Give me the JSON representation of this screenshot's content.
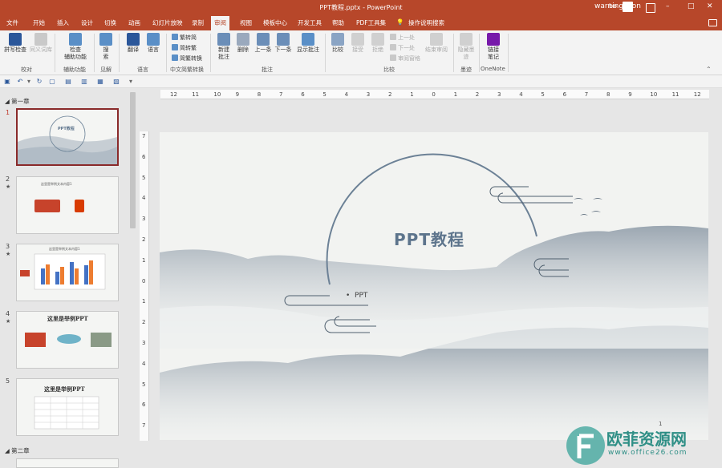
{
  "window": {
    "title": "PPT教程.pptx  -  PowerPoint",
    "user": "bo",
    "warn_icon": "warning-icon",
    "min": "–",
    "max": "□",
    "close": "✕"
  },
  "tabs": [
    "文件",
    "开始",
    "插入",
    "设计",
    "切换",
    "动画",
    "幻灯片放映",
    "录制",
    "审阅",
    "视图",
    "模板中心",
    "开发工具",
    "帮助",
    "PDF工具集",
    "操作说明搜索"
  ],
  "active_tab": "审阅",
  "ribbon": {
    "spell": "拼写检查",
    "thesaurus": "同义词库",
    "group_proof": "校对",
    "check_a": "检查",
    "check_b": "辅助功能",
    "group_access": "辅助功能",
    "search_a": "搜",
    "search_b": "索",
    "group_insight": "见解",
    "translate": "翻译",
    "language": "语言",
    "group_lang": "语言",
    "trad": "繁转简",
    "simp": "简转繁",
    "conv": "简繁转换",
    "group_chinese": "中文简繁转换",
    "new_a": "新建",
    "new_b": "批注",
    "delete": "删除",
    "prev": "上一条",
    "next": "下一条",
    "show_a": "显示批注",
    "group_comments": "批注",
    "compare": "比较",
    "accept": "接受",
    "reject": "拒绝",
    "prev2": "上一处",
    "next2": "下一处",
    "pane": "审阅窗格",
    "end": "结束审阅",
    "group_compare": "比较",
    "hide_a": "隐藏墨",
    "hide_b": "迹",
    "group_ink": "墨迹",
    "link_a": "链接",
    "link_b": "笔记",
    "group_onenote": "OneNote"
  },
  "sections": [
    "第一章",
    "第二章"
  ],
  "slides": [
    {
      "num": "1",
      "title": "PPT教程",
      "star": ""
    },
    {
      "num": "2",
      "title": "这里是举例文本内容1",
      "star": "★"
    },
    {
      "num": "3",
      "title": "这里是举例文本内容1",
      "star": "★"
    },
    {
      "num": "4",
      "title": "这里是举例PPT",
      "star": "★"
    },
    {
      "num": "5",
      "title": "这里是举例PPT",
      "star": ""
    }
  ],
  "hruler": [
    "12",
    "11",
    "10",
    "9",
    "8",
    "7",
    "6",
    "5",
    "4",
    "3",
    "2",
    "1",
    "0",
    "1",
    "2",
    "3",
    "4",
    "5",
    "6",
    "7",
    "8",
    "9",
    "10",
    "11",
    "12"
  ],
  "vruler": [
    "7",
    "6",
    "5",
    "4",
    "3",
    "2",
    "1",
    "0",
    "1",
    "2",
    "3",
    "4",
    "5",
    "6",
    "7"
  ],
  "slide": {
    "title": "PPT教程",
    "bullet": "PPT",
    "page": "1"
  },
  "watermark": {
    "brand": "欧菲资源网",
    "url": "www.office26.com"
  },
  "colors": {
    "accent": "#b7472a",
    "slide_title": "#5d748c"
  }
}
